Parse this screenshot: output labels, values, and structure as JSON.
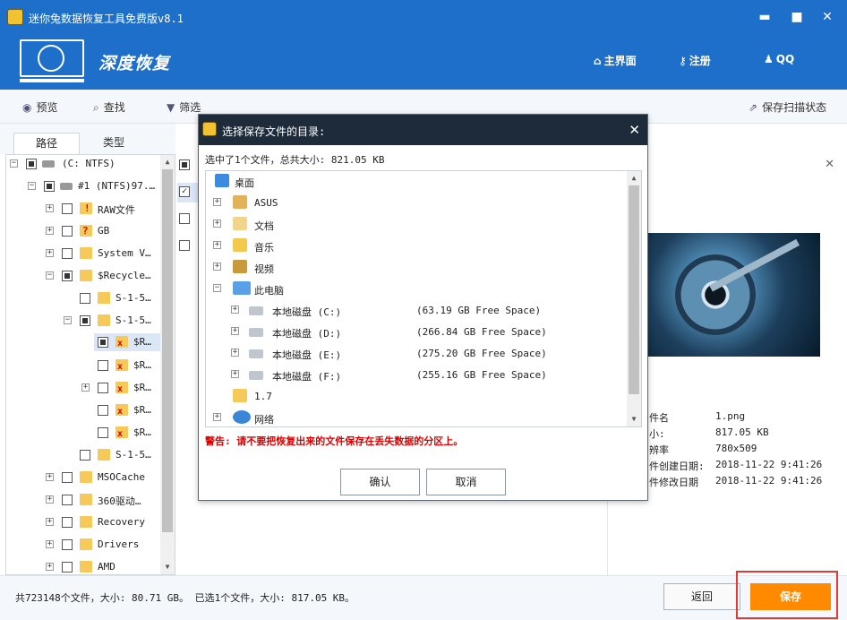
{
  "window": {
    "title": "迷你兔数据恢复工具免费版v8.1",
    "minimize": "▬",
    "maximize": "■",
    "close": "✕"
  },
  "header": {
    "app_title": "深度恢复",
    "nav": [
      {
        "label": "主界面",
        "icon": "home-icon"
      },
      {
        "label": "注册",
        "icon": "key-icon"
      },
      {
        "label": "QQ",
        "icon": "qq-icon"
      }
    ]
  },
  "toolbar": {
    "preview": "预览",
    "find": "查找",
    "filter": "筛选",
    "save_scan": "保存扫描状态"
  },
  "tabs": [
    "路径",
    "类型"
  ],
  "tree": {
    "items": [
      {
        "label": "(C: NTFS)"
      },
      {
        "label": "#1 (NTFS)97.…"
      },
      {
        "label": "RAW文件"
      },
      {
        "label": "GB"
      },
      {
        "label": "System V…"
      },
      {
        "label": "$Recycle…"
      },
      {
        "label": "S-1-5…"
      },
      {
        "label": "S-1-5…"
      },
      {
        "label": "$R…"
      },
      {
        "label": "$R…"
      },
      {
        "label": "$R…"
      },
      {
        "label": "$R…"
      },
      {
        "label": "$R…"
      },
      {
        "label": "S-1-5…"
      },
      {
        "label": "MSOCache"
      },
      {
        "label": "360驱动…"
      },
      {
        "label": "Recovery"
      },
      {
        "label": "Drivers"
      },
      {
        "label": "AMD"
      }
    ]
  },
  "preview": {
    "rows": [
      {
        "key": "件名",
        "value": "1.png"
      },
      {
        "key": "小:",
        "value": "817.05 KB"
      },
      {
        "key": "辨率",
        "value": "780x509"
      },
      {
        "key": "件创建日期:",
        "value": "2018-11-22 9:41:26"
      },
      {
        "key": "件修改日期",
        "value": "2018-11-22 9:41:26"
      }
    ]
  },
  "status": {
    "text": "共723148个文件，大小: 80.71 GB。 已选1个文件，大小: 817.05 KB。",
    "back": "返回",
    "save": "保存"
  },
  "dialog": {
    "title": "选择保存文件的目录:",
    "close": "✕",
    "info": "选中了1个文件，总共大小: 821.05 KB",
    "tree": [
      {
        "label": "桌面",
        "free": ""
      },
      {
        "label": "ASUS",
        "free": ""
      },
      {
        "label": "文档",
        "free": ""
      },
      {
        "label": "音乐",
        "free": ""
      },
      {
        "label": "视频",
        "free": ""
      },
      {
        "label": "此电脑",
        "free": ""
      },
      {
        "label": "本地磁盘 (C:)",
        "free": "(63.19 GB Free Space)"
      },
      {
        "label": "本地磁盘 (D:)",
        "free": "(266.84 GB Free Space)"
      },
      {
        "label": "本地磁盘 (E:)",
        "free": "(275.20 GB Free Space)"
      },
      {
        "label": "本地磁盘 (F:)",
        "free": "(255.16 GB Free Space)"
      },
      {
        "label": "1.7",
        "free": ""
      },
      {
        "label": "网络",
        "free": ""
      }
    ],
    "warning": "警告: 请不要把恢复出来的文件保存在丢失数据的分区上。",
    "ok": "确认",
    "cancel": "取消"
  },
  "colors": {
    "header_blue": "#1e6fca",
    "dialog_title": "#1e2b3b",
    "save_orange": "#ff8a00",
    "warning_red": "#dd0000"
  }
}
